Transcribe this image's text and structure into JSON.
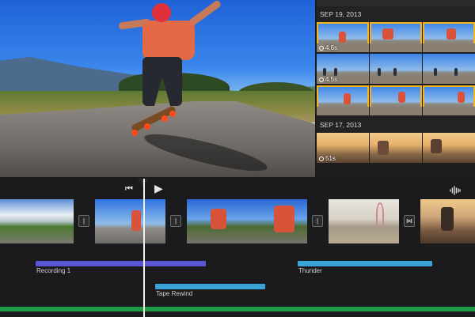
{
  "browser": {
    "sections": [
      {
        "date": "SEP 19, 2013"
      },
      {
        "date": "SEP 17, 2013"
      }
    ],
    "durations": {
      "clip_a": "4.6s",
      "clip_b": "4.5s",
      "clip_c": "51s"
    }
  },
  "timeline": {
    "controls": {
      "rewind": "⏮",
      "play": "▶",
      "audio": "audio-waveform"
    },
    "audio_tracks": [
      {
        "label": "Recording 1",
        "color": "#5a55d6"
      },
      {
        "label": "Thunder",
        "color": "#3aa3d8"
      },
      {
        "label": "Tape Rewind",
        "color": "#3aa3d8"
      }
    ],
    "music_color": "#1e9a44"
  }
}
